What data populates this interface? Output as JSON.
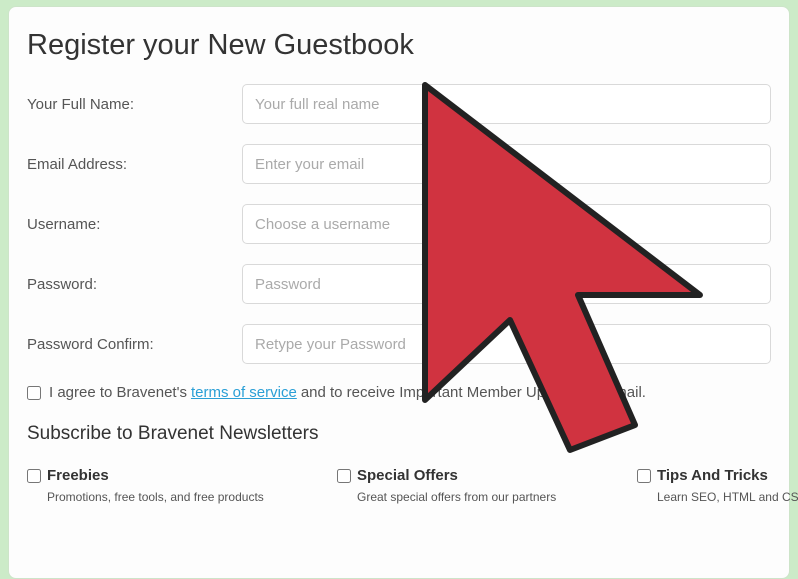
{
  "title": "Register your New Guestbook",
  "fields": {
    "fullname": {
      "label": "Your Full Name:",
      "placeholder": "Your full real name"
    },
    "email": {
      "label": "Email Address:",
      "placeholder": "Enter your email"
    },
    "username": {
      "label": "Username:",
      "placeholder": "Choose a username"
    },
    "password": {
      "label": "Password:",
      "placeholder": "Password"
    },
    "password_confirm": {
      "label": "Password Confirm:",
      "placeholder": "Retype your Password"
    }
  },
  "agree": {
    "before": "I agree to Bravenet's",
    "link": "terms of service",
    "after": "and to receive Important Member Updates by email."
  },
  "subsection_title": "Subscribe to Bravenet Newsletters",
  "newsletters": {
    "freebies": {
      "title": "Freebies",
      "desc": "Promotions, free tools, and free products"
    },
    "special": {
      "title": "Special Offers",
      "desc": "Great special offers from our partners"
    },
    "tips": {
      "title": "Tips And Tricks",
      "desc": "Learn SEO, HTML and CSS a"
    }
  }
}
